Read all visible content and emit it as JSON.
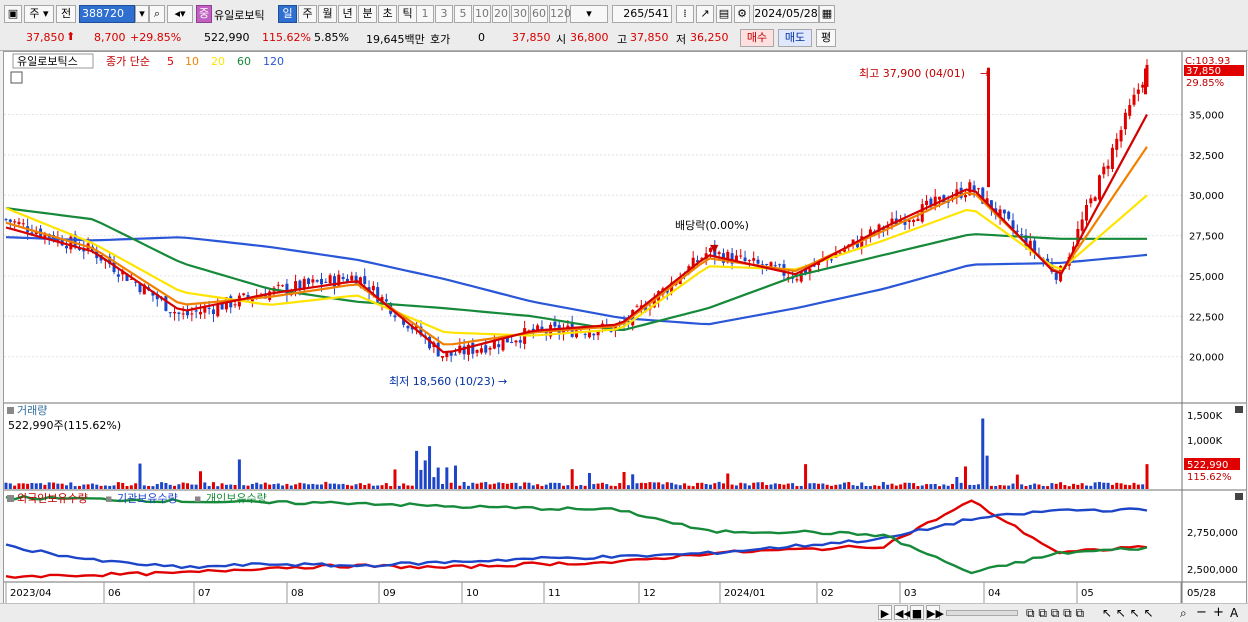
{
  "toolbar": {
    "market": "주",
    "prev": "전",
    "code": "388720",
    "name": "유일로보틱",
    "period_badge": "중",
    "periods": [
      "일",
      "주",
      "월",
      "년",
      "분",
      "초",
      "틱"
    ],
    "intervals": [
      "1",
      "3",
      "5",
      "10",
      "20",
      "30",
      "60",
      "120"
    ],
    "count": "265",
    "total": "/541",
    "date": "2024/05/28"
  },
  "quote": {
    "price": "37,850",
    "change": "8,700",
    "rate": "+29.85%",
    "volume": "522,990",
    "vol_rate": "115.62%",
    "turnover": "5.85%",
    "amount": "19,645백만",
    "hoga_label": "호가",
    "hoga": "0",
    "hoga_price": "37,850",
    "open_label": "시",
    "open": "36,800",
    "high_label": "고",
    "high": "37,850",
    "low_label": "저",
    "low": "36,250",
    "buy": "매수",
    "sell": "매도",
    "avg": "평"
  },
  "price_panel": {
    "stock_label": "유일로보틱스",
    "ma_prefix": "종가 단순",
    "ma_labels": [
      "5",
      "10",
      "20",
      "60",
      "120"
    ],
    "ma_colors": [
      "#d40000",
      "#f08000",
      "#ffe400",
      "#168a3a",
      "#2a56d8"
    ],
    "axis": [
      "35,000",
      "32,500",
      "30,000",
      "27,500",
      "25,000",
      "22,500",
      "20,000"
    ],
    "axis_values": [
      35000,
      32500,
      30000,
      27500,
      25000,
      22500,
      20000
    ],
    "close_tag": "C:103.93",
    "price_tag": "37,850",
    "pct_tag": "29.85%",
    "high_note": "최고 37,900 (04/01)",
    "low_note": "최저 18,560 (10/23)",
    "div_note": "배당락(0.00%)"
  },
  "volume_panel": {
    "label": "거래량",
    "value": "522,990주(115.62%)",
    "axis": [
      "1,500K",
      "1,000K"
    ],
    "tag": "522,990",
    "tag2": "115.62%"
  },
  "holder_panel": {
    "labels": [
      "외국인보유수량",
      "기관보유수량",
      "개인보유수량"
    ],
    "axis": [
      "2,750,000",
      "2,500,000"
    ]
  },
  "x_axis": [
    "2023/04",
    "06",
    "07",
    "08",
    "09",
    "10",
    "11",
    "12",
    "2024/01",
    "02",
    "03",
    "04",
    "05",
    "05/28"
  ],
  "chart_data": {
    "type": "line",
    "title": "유일로보틱스",
    "x": [
      "2023/04",
      "06",
      "07",
      "08",
      "09",
      "10",
      "11",
      "12",
      "2024/01",
      "02",
      "03",
      "04",
      "05",
      "05/28"
    ],
    "series": [
      {
        "name": "종가",
        "values": [
          28500,
          26500,
          22500,
          24000,
          25000,
          20000,
          21500,
          21800,
          26500,
          25000,
          28000,
          30500,
          25000,
          37850
        ]
      },
      {
        "name": "5",
        "values": [
          28000,
          26500,
          22800,
          23900,
          24700,
          20200,
          21600,
          22000,
          26300,
          25100,
          28000,
          30500,
          24900,
          35000
        ]
      },
      {
        "name": "10",
        "values": [
          28300,
          26700,
          23200,
          23700,
          24500,
          20700,
          21500,
          21900,
          26100,
          25300,
          27800,
          30300,
          25000,
          33000
        ]
      },
      {
        "name": "20",
        "values": [
          29200,
          27000,
          24000,
          23200,
          23800,
          21500,
          21300,
          21700,
          25600,
          25400,
          27200,
          29200,
          25300,
          30000
        ]
      },
      {
        "name": "60",
        "values": [
          29200,
          28500,
          25800,
          24200,
          23400,
          23000,
          22500,
          21600,
          23000,
          25000,
          26300,
          27600,
          27300,
          27300
        ]
      },
      {
        "name": "120",
        "values": [
          27400,
          27200,
          27400,
          26800,
          26000,
          24800,
          23400,
          22400,
          22000,
          23000,
          24200,
          25700,
          25800,
          26300
        ]
      }
    ],
    "ylim": [
      17500,
      38500
    ],
    "high": 37900,
    "low": 18560
  },
  "status_icons": [
    "play-icon",
    "rewind-icon",
    "stop-icon",
    "forward-icon"
  ]
}
